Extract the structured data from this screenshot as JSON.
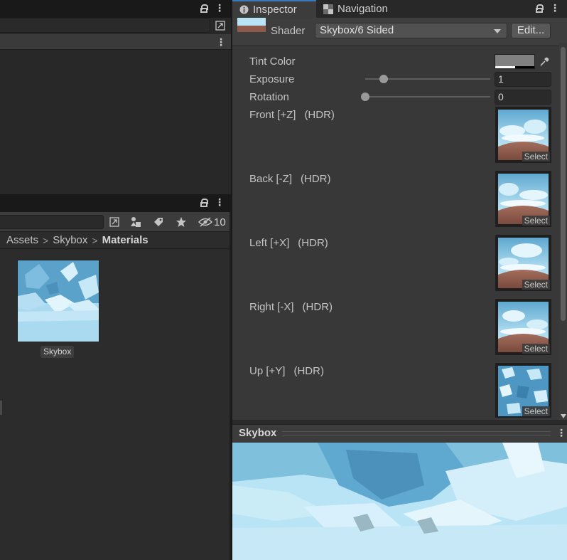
{
  "project_panel": {
    "breadcrumb": [
      "Assets",
      "Skybox",
      "Materials"
    ],
    "hidden_count": "10",
    "asset": {
      "name": "Skybox"
    }
  },
  "inspector": {
    "tabs": [
      {
        "label": "Inspector",
        "icon": "info-icon",
        "active": true
      },
      {
        "label": "Navigation",
        "icon": "navigation-icon",
        "active": false
      }
    ],
    "shader_label": "Shader",
    "shader_value": "Skybox/6 Sided",
    "edit_label": "Edit...",
    "properties": {
      "tint_color": {
        "label": "Tint Color"
      },
      "exposure": {
        "label": "Exposure",
        "value": "1",
        "slider_fraction": 0.15
      },
      "rotation": {
        "label": "Rotation",
        "value": "0",
        "slider_fraction": 0.0
      }
    },
    "textures": [
      {
        "label": "Front [+Z]",
        "hdr": "(HDR)",
        "select": "Select"
      },
      {
        "label": "Back [-Z]",
        "hdr": "(HDR)",
        "select": "Select"
      },
      {
        "label": "Left [+X]",
        "hdr": "(HDR)",
        "select": "Select"
      },
      {
        "label": "Right [-X]",
        "hdr": "(HDR)",
        "select": "Select"
      },
      {
        "label": "Up [+Y]",
        "hdr": "(HDR)",
        "select": "Select"
      }
    ],
    "preview_title": "Skybox"
  },
  "colors": {
    "accent": "#3a79bb",
    "panel_bg": "#383838",
    "dark_bg": "#282828",
    "sky_light": "#b8e4f5",
    "sky_mid": "#7fc1dd",
    "sky_dark": "#3e8ab4",
    "ground": "#8e5a4b"
  }
}
